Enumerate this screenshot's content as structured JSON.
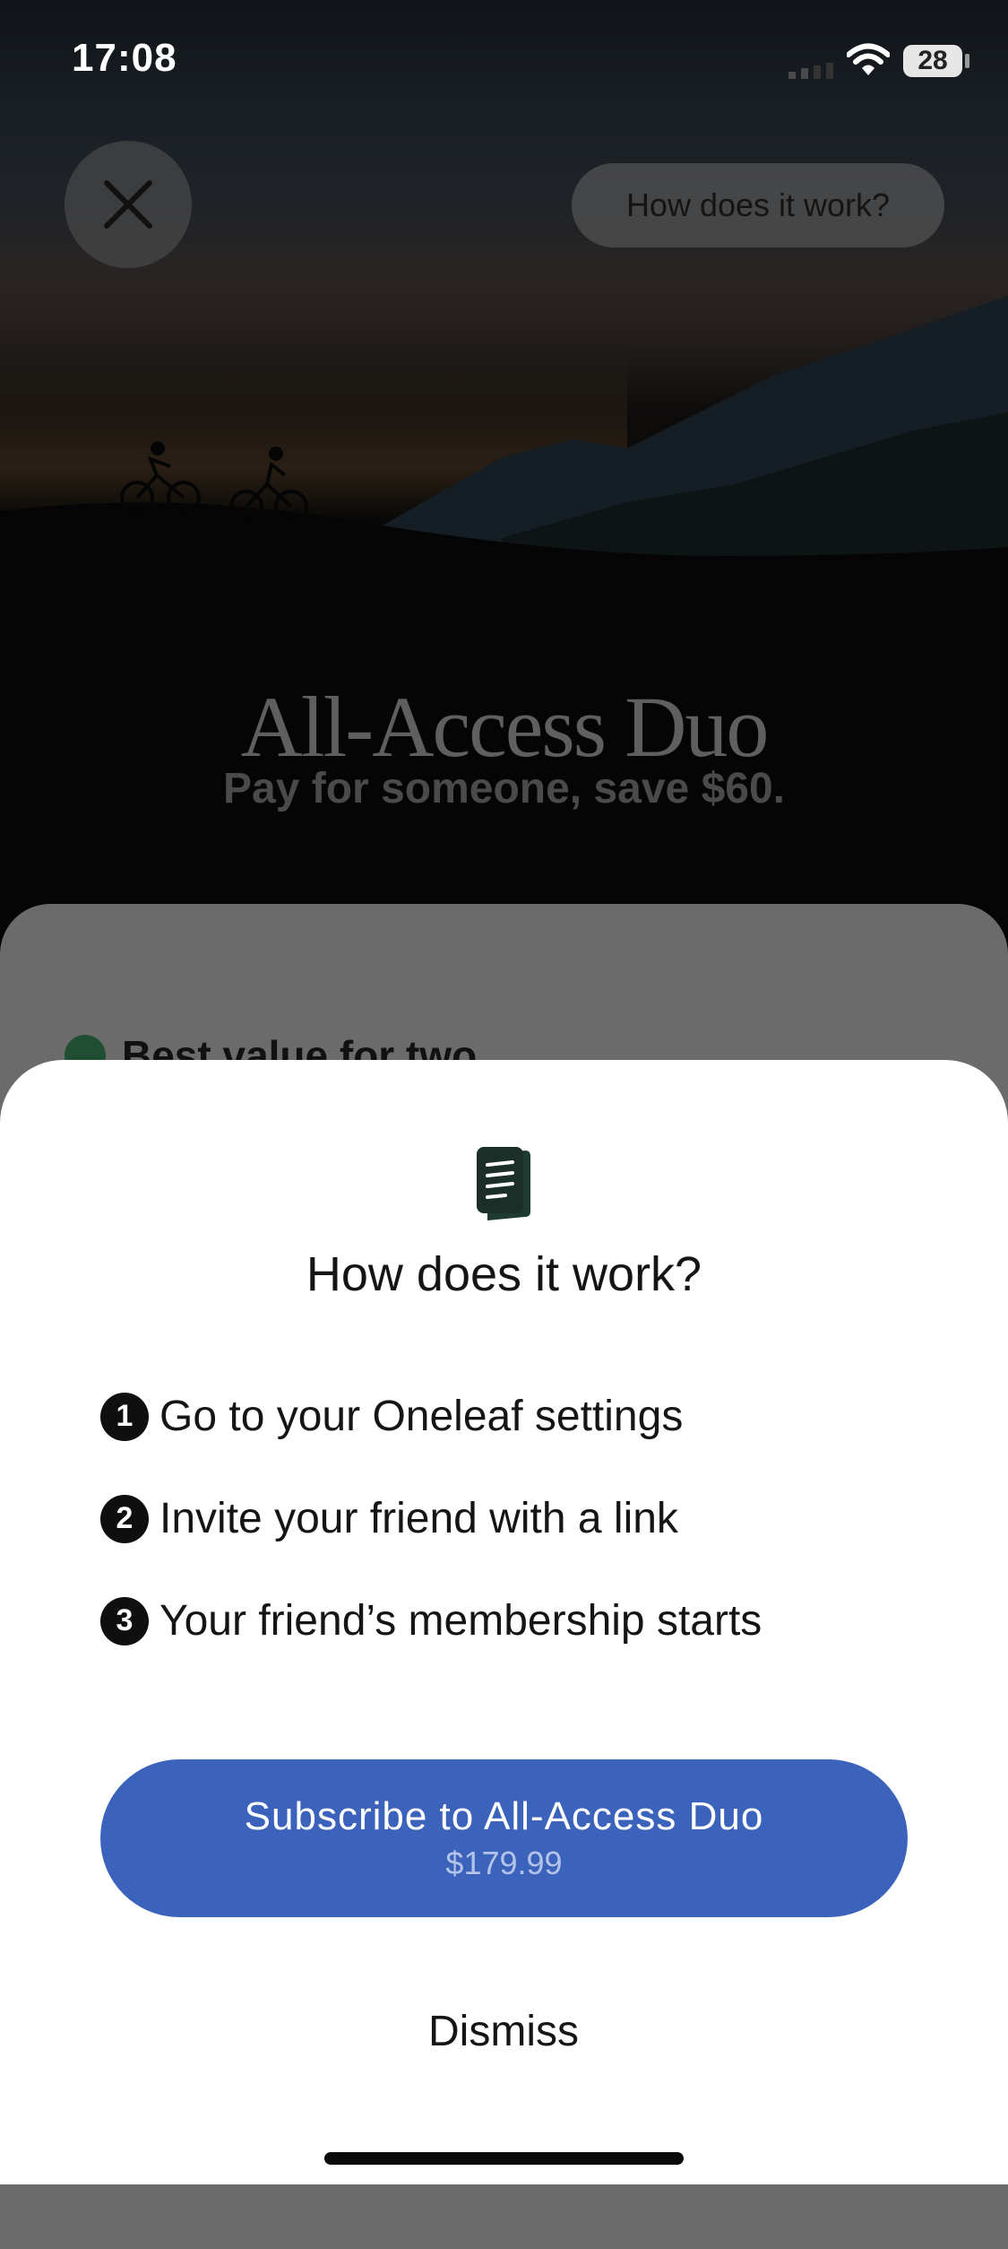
{
  "status_bar": {
    "time": "17:08",
    "battery": "28"
  },
  "header": {
    "how_button_label": "How does it work?"
  },
  "hero": {
    "title": "All-Access Duo",
    "subtitle": "Pay for someone, save $60."
  },
  "background_card": {
    "benefit_label": "Best value for two"
  },
  "sheet": {
    "title": "How does it work?",
    "steps": [
      {
        "number": "1",
        "label": "Go to your Oneleaf settings"
      },
      {
        "number": "2",
        "label": "Invite your friend with a link"
      },
      {
        "number": "3",
        "label": "Your friend’s membership starts"
      }
    ],
    "subscribe_label": "Subscribe to All-Access Duo",
    "subscribe_price": "$179.99",
    "dismiss_label": "Dismiss"
  },
  "colors": {
    "accent": "#3c63bc",
    "text": "#151515",
    "sheet_bg": "#ffffff",
    "check": "#1f4e33"
  }
}
